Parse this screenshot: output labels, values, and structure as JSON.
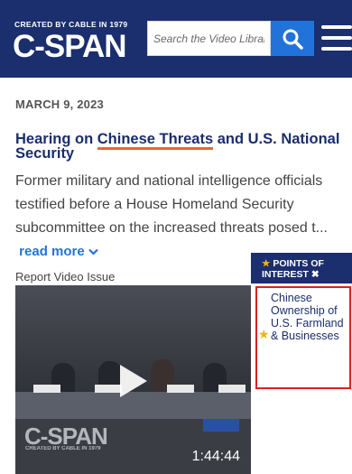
{
  "header": {
    "tagline": "CREATED BY CABLE IN 1979",
    "logo": "C-SPAN",
    "search": {
      "placeholder": "Search the Video Library"
    }
  },
  "article": {
    "date": "MARCH 9, 2023",
    "title_pre": "Hearing on ",
    "title_highlight": "Chinese Threats",
    "title_post": " and U.S. National Security",
    "description": "Former military and national intelligence officials testified before a House Homeland Security subcommittee on the increased threats posed t...",
    "read_more": "read more",
    "report_link": "Report Video Issue"
  },
  "video": {
    "watermark_logo": "C-SPAN",
    "watermark_tagline": "CREATED BY CABLE IN 1979",
    "duration": "1:44:44"
  },
  "points_of_interest": {
    "header_line1": "POINTS OF",
    "header_line2": "INTEREST",
    "items": [
      "Chinese Ownership of U.S. Farmland & Businesses"
    ]
  },
  "colors": {
    "brand_navy": "#1b2e6d",
    "accent_blue": "#2273d9",
    "highlight_orange": "#e8662a",
    "poi_border": "#d9231d",
    "star": "#f2b01e"
  }
}
